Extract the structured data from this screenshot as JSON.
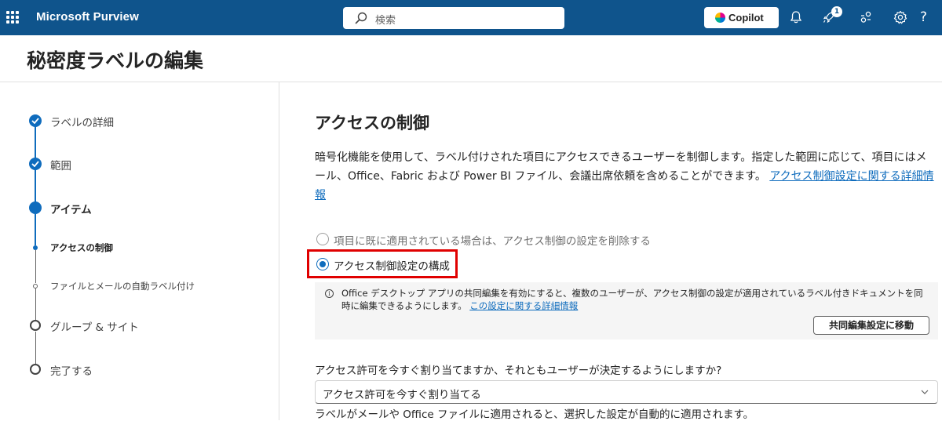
{
  "topbar": {
    "app_title": "Microsoft Purview",
    "search_placeholder": "検索",
    "copilot_label": "Copilot",
    "notification_count": "1",
    "help_label": "?",
    "icons": [
      "waffle-icon",
      "search-icon",
      "copilot-icon",
      "bell-icon",
      "rocket-icon",
      "people-connect-icon",
      "gear-icon",
      "help-icon"
    ]
  },
  "page": {
    "title": "秘密度ラベルの編集"
  },
  "steps": [
    {
      "label": "ラベルの詳細",
      "state": "completed"
    },
    {
      "label": "範囲",
      "state": "completed"
    },
    {
      "label": "アイテム",
      "state": "current"
    },
    {
      "label": "アクセスの制御",
      "state": "current-sub"
    },
    {
      "label": "ファイルとメールの自動ラベル付け",
      "state": "pending-sub"
    },
    {
      "label": "グループ & サイト",
      "state": "pending"
    },
    {
      "label": "完了する",
      "state": "pending"
    }
  ],
  "main": {
    "section_title": "アクセスの制御",
    "description": "暗号化機能を使用して、ラベル付けされた項目にアクセスできるユーザーを制御します。指定した範囲に応じて、項目にはメール、Office、Fabric および Power BI ファイル、会議出席依頼を含めることができます。",
    "description_link": "アクセス制御設定に関する詳細情報",
    "radio_options": [
      {
        "label": "項目に既に適用されている場合は、アクセス制御の設定を削除する",
        "selected": false,
        "enabled": false
      },
      {
        "label": "アクセス制御設定の構成",
        "selected": true,
        "enabled": true
      }
    ],
    "info": {
      "text": "Office デスクトップ アプリの共同編集を有効にすると、複数のユーザーが、アクセス制御の設定が適用されているラベル付きドキュメントを同時に編集できるようにします。",
      "link": "この設定に関する詳細情報",
      "button": "共同編集設定に移動"
    },
    "question": "アクセス許可を今すぐ割り当てますか、それともユーザーが決定するようにしますか?",
    "dropdown_value": "アクセス許可を今すぐ割り当てる",
    "footnote": "ラベルがメールや Office ファイルに適用されると、選択した設定が自動的に適用されます。"
  },
  "colors": {
    "topbar": "#0f548c",
    "accent": "#0f6cbd",
    "highlight": "#e00000"
  }
}
